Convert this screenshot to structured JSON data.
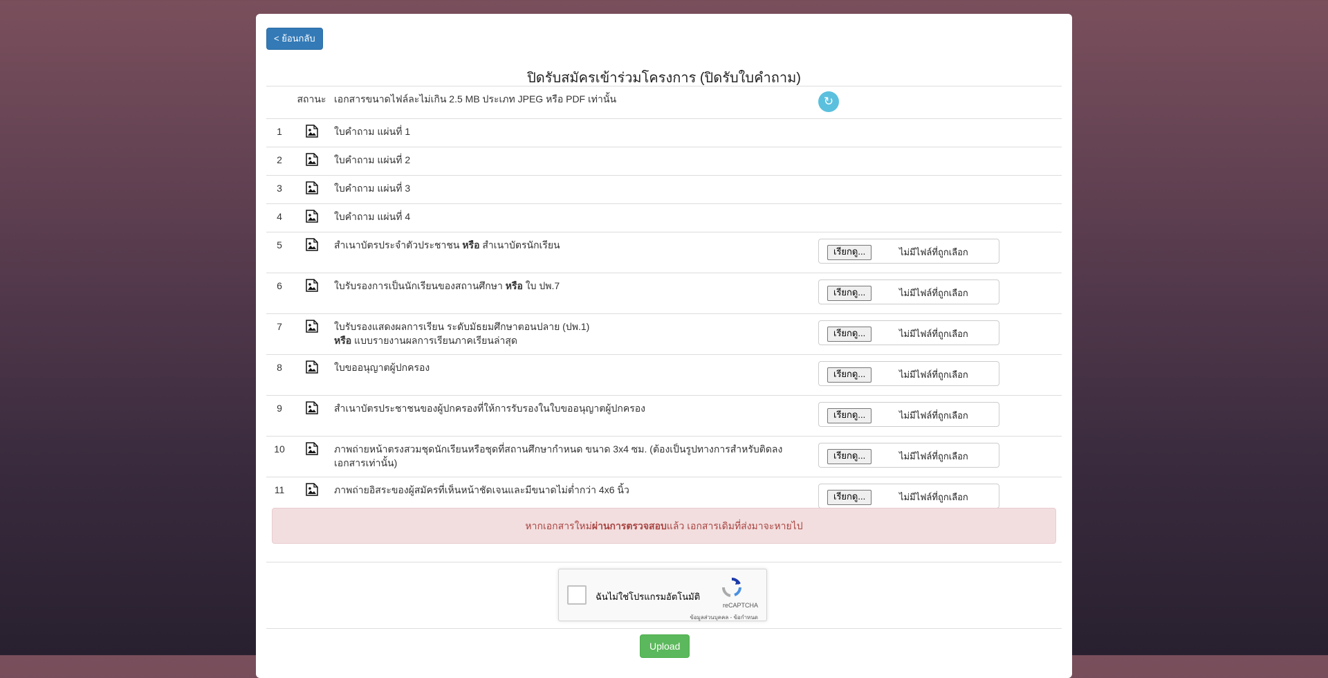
{
  "back_label": "< ย้อนกลับ",
  "title": "ปิดรับสมัครเข้าร่วมโครงการ (ปิดรับใบคำถาม)",
  "table": {
    "status_header": "สถานะ",
    "note_header": "เอกสารขนาดไฟล์ละไม่เกิน 2.5 MB ประเภท JPEG หรือ PDF เท่านั้น",
    "refresh_icon": "refresh-icon",
    "rows": [
      {
        "num": "1",
        "desc": "ใบคำถาม แผ่นที่ 1"
      },
      {
        "num": "2",
        "desc": "ใบคำถาม แผ่นที่ 2"
      },
      {
        "num": "3",
        "desc": "ใบคำถาม แผ่นที่ 3"
      },
      {
        "num": "4",
        "desc": "ใบคำถาม แผ่นที่ 4"
      },
      {
        "num": "5",
        "d1": "สำเนาบัตรประจำตัวประชาชน ",
        "b1": "หรือ",
        "d2": " สำเนาบัตรนักเรียน"
      },
      {
        "num": "6",
        "d1": "ใบรับรองการเป็นนักเรียนของสถานศึกษา ",
        "b1": "หรือ",
        "d2": " ใบ ปพ.7"
      },
      {
        "num": "7",
        "d1": "ใบรับรองแสดงผลการเรียน ระดับมัธยมศึกษาตอนปลาย (ปพ.1)",
        "b1": "หรือ",
        "d2": " แบบรายงานผลการเรียนภาคเรียนล่าสุด"
      },
      {
        "num": "8",
        "desc": "ใบขออนุญาตผู้ปกครอง"
      },
      {
        "num": "9",
        "desc": "สำเนาบัตรประชาชนของผู้ปกครองที่ให้การรับรองในใบขออนุญาตผู้ปกครอง"
      },
      {
        "num": "10",
        "desc": "ภาพถ่ายหน้าตรงสวมชุดนักเรียนหรือชุดที่สถานศึกษากำหนด ขนาด 3x4 ซม. (ต้องเป็นรูปทางการสำหรับติดลงเอกสารเท่านั้น)"
      },
      {
        "num": "11",
        "desc": "ภาพถ่ายอิสระของผู้สมัครที่เห็นหน้าชัดเจนและมีขนาดไม่ต่ำกว่า 4x6 นิ้ว"
      }
    ],
    "file_button": "เรียกดู...",
    "file_status": "ไม่มีไฟล์ที่ถูกเลือก"
  },
  "alert": {
    "pre": "หากเอกสารใหม่",
    "bold": "ผ่านการตรวจสอบ",
    "post": "แล้ว เอกสารเดิมที่ส่งมาจะหายไป"
  },
  "recaptcha": {
    "label": "ฉันไม่ใช่โปรแกรมอัตโนมัติ",
    "brand": "reCAPTCHA",
    "terms": "ข้อมูลส่วนบุคคล - ข้อกำหนด"
  },
  "upload_label": "Upload",
  "colors": {
    "primary": "#337ab7",
    "info": "#5bc0de",
    "success": "#5cb85c",
    "alert_bg": "#f2dede",
    "alert_text": "#a94442"
  }
}
